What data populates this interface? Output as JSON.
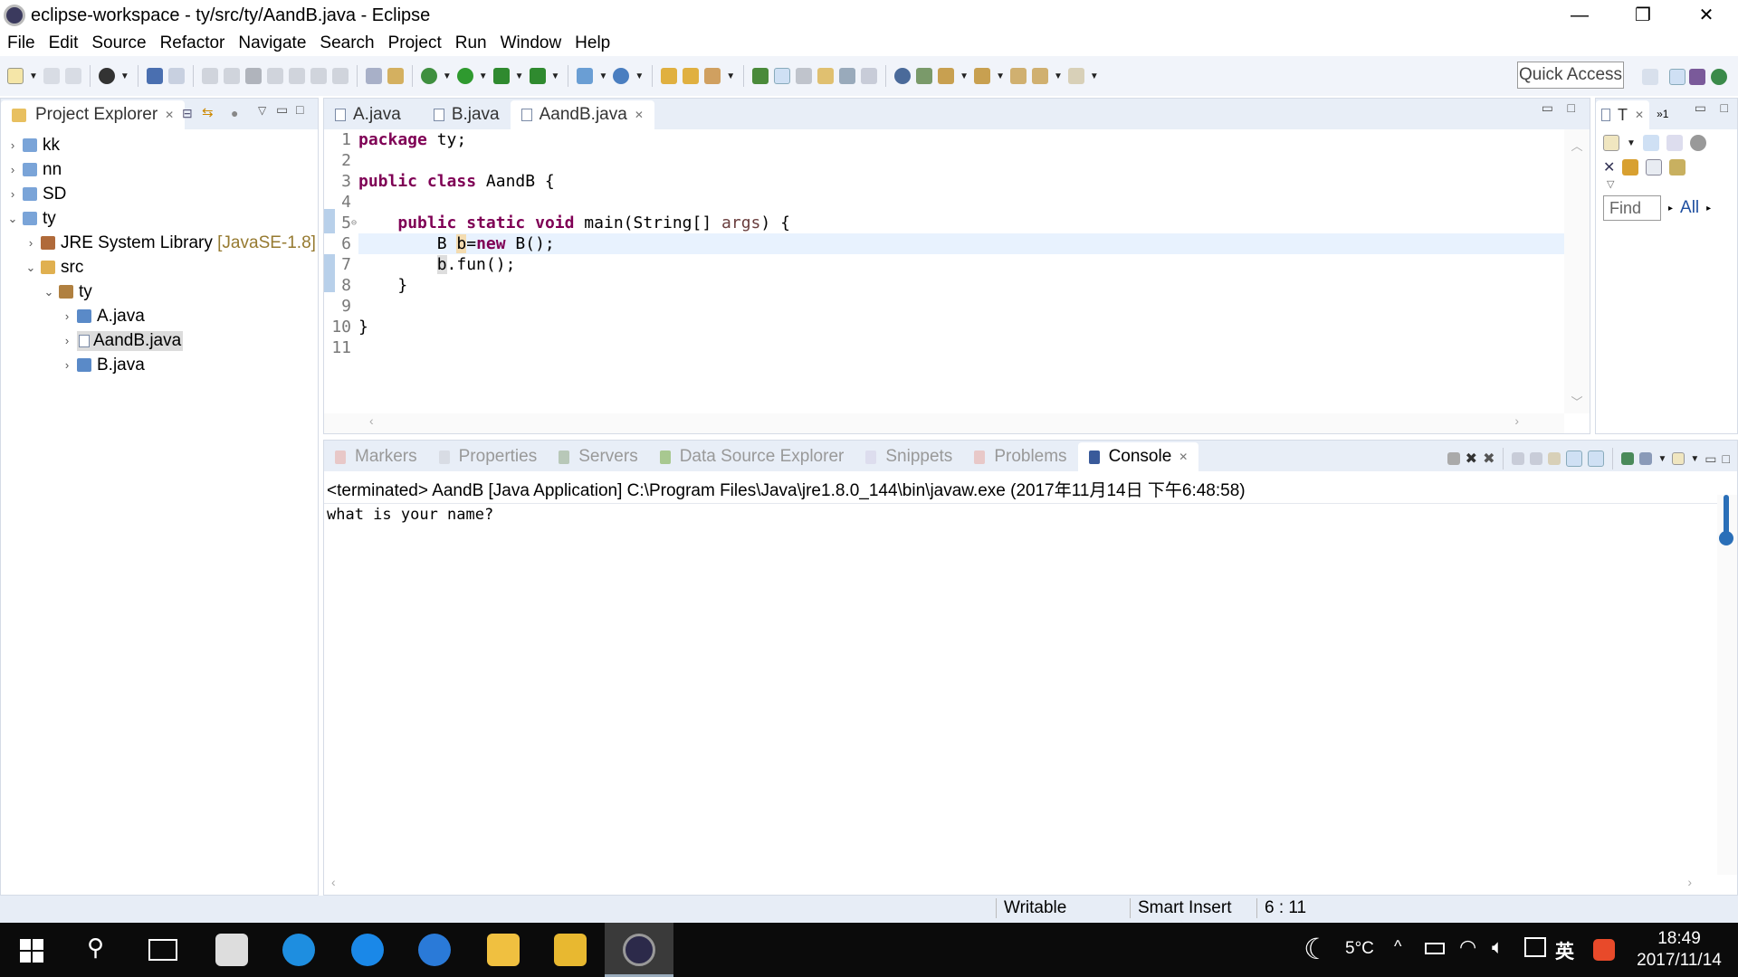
{
  "window": {
    "title": "eclipse-workspace - ty/src/ty/AandB.java - Eclipse"
  },
  "menu": [
    "File",
    "Edit",
    "Source",
    "Refactor",
    "Navigate",
    "Search",
    "Project",
    "Run",
    "Window",
    "Help"
  ],
  "toolbar": {
    "quick_access": "Quick Access"
  },
  "explorer": {
    "title": "Project Explorer",
    "items": [
      {
        "label": "kk"
      },
      {
        "label": "nn"
      },
      {
        "label": "SD"
      },
      {
        "label": "ty"
      },
      {
        "label": "JRE System Library",
        "suffix": "[JavaSE-1.8]"
      },
      {
        "label": "src"
      },
      {
        "label": "ty"
      },
      {
        "label": "A.java"
      },
      {
        "label": "AandB.java"
      },
      {
        "label": "B.java"
      }
    ]
  },
  "editor": {
    "tabs": [
      "A.java",
      "B.java",
      "AandB.java"
    ],
    "active_tab": "AandB.java",
    "line_numbers": [
      "1",
      "2",
      "3",
      "4",
      "5",
      "6",
      "7",
      "8",
      "9",
      "10",
      "11"
    ]
  },
  "outline": {
    "tab_label": "T",
    "overflow": "1",
    "find_placeholder": "Find",
    "all_label": "All"
  },
  "console": {
    "tabs": [
      "Markers",
      "Properties",
      "Servers",
      "Data Source Explorer",
      "Snippets",
      "Problems",
      "Console"
    ],
    "header": "<terminated> AandB [Java Application] C:\\Program Files\\Java\\jre1.8.0_144\\bin\\javaw.exe (2017年11月14日 下午6:48:58)",
    "output": "what is your name?"
  },
  "status": {
    "writable": "Writable",
    "insert_mode": "Smart Insert",
    "position": "6 : 11"
  },
  "taskbar": {
    "weather": "5°C",
    "ime": "英",
    "time": "18:49",
    "date": "2017/11/14"
  },
  "colors": {
    "keyword": "#7f0055",
    "taskbar": "#0b0b0b",
    "selection": "#e8f2fe"
  }
}
